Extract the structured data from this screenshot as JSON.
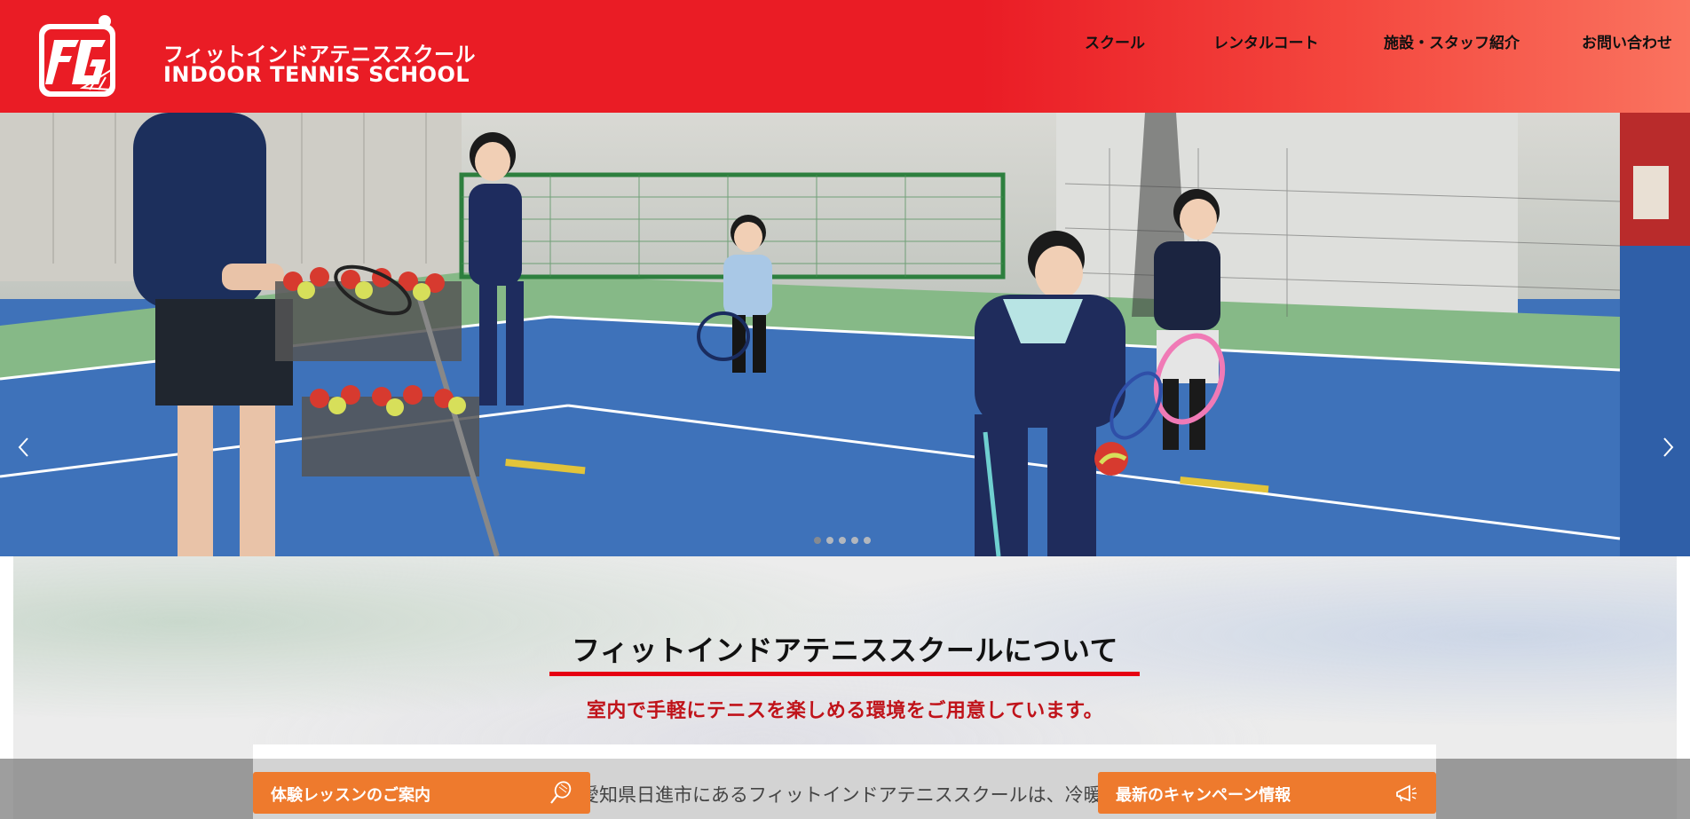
{
  "header": {
    "logo_text": "FIT",
    "title_ja": "フィットインドアテニススクール",
    "title_en": "INDOOR TENNIS SCHOOL",
    "nav": [
      {
        "label": "スクール"
      },
      {
        "label": "レンタルコート"
      },
      {
        "label": "施設・スタッフ紹介"
      },
      {
        "label": "お問い合わせ"
      }
    ]
  },
  "hero": {
    "slide_count": 5,
    "active_slide": 1,
    "prev_icon": "chevron-left-icon",
    "next_icon": "chevron-right-icon"
  },
  "about": {
    "title": "フィットインドアテニススクールについて",
    "subtitle": "室内で手軽にテニスを楽しめる環境をご用意しています。",
    "body_excerpt": "愛知県日進市にあるフィットインドアテニススクールは、冷暖房完備"
  },
  "cta": {
    "trial_label": "体験レッスンのご案内",
    "trial_icon": "tennis-racket-icon",
    "campaign_label": "最新のキャンペーン情報",
    "campaign_icon": "megaphone-icon"
  },
  "colors": {
    "header_red": "#ea1c25",
    "accent_rule": "#e60012",
    "subtitle_red": "#c0131a",
    "cta_orange": "#ee7a2d"
  }
}
